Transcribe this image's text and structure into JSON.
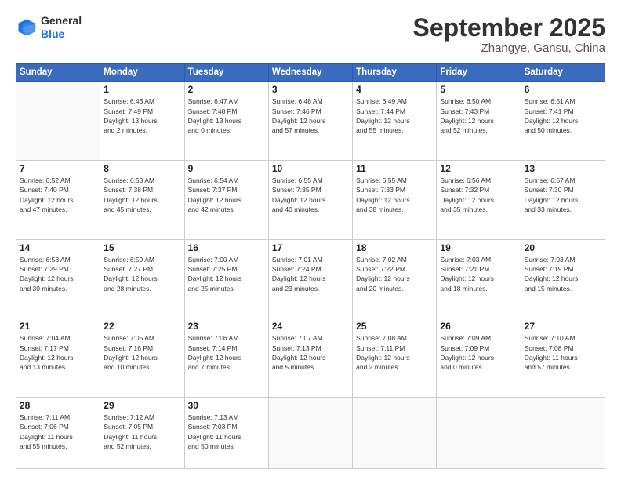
{
  "logo": {
    "line1": "General",
    "line2": "Blue"
  },
  "header": {
    "title": "September 2025",
    "subtitle": "Zhangye, Gansu, China"
  },
  "weekdays": [
    "Sunday",
    "Monday",
    "Tuesday",
    "Wednesday",
    "Thursday",
    "Friday",
    "Saturday"
  ],
  "weeks": [
    [
      {
        "day": "",
        "info": ""
      },
      {
        "day": "1",
        "info": "Sunrise: 6:46 AM\nSunset: 7:49 PM\nDaylight: 13 hours\nand 2 minutes."
      },
      {
        "day": "2",
        "info": "Sunrise: 6:47 AM\nSunset: 7:48 PM\nDaylight: 13 hours\nand 0 minutes."
      },
      {
        "day": "3",
        "info": "Sunrise: 6:48 AM\nSunset: 7:46 PM\nDaylight: 12 hours\nand 57 minutes."
      },
      {
        "day": "4",
        "info": "Sunrise: 6:49 AM\nSunset: 7:44 PM\nDaylight: 12 hours\nand 55 minutes."
      },
      {
        "day": "5",
        "info": "Sunrise: 6:50 AM\nSunset: 7:43 PM\nDaylight: 12 hours\nand 52 minutes."
      },
      {
        "day": "6",
        "info": "Sunrise: 6:51 AM\nSunset: 7:41 PM\nDaylight: 12 hours\nand 50 minutes."
      }
    ],
    [
      {
        "day": "7",
        "info": "Sunrise: 6:52 AM\nSunset: 7:40 PM\nDaylight: 12 hours\nand 47 minutes."
      },
      {
        "day": "8",
        "info": "Sunrise: 6:53 AM\nSunset: 7:38 PM\nDaylight: 12 hours\nand 45 minutes."
      },
      {
        "day": "9",
        "info": "Sunrise: 6:54 AM\nSunset: 7:37 PM\nDaylight: 12 hours\nand 42 minutes."
      },
      {
        "day": "10",
        "info": "Sunrise: 6:55 AM\nSunset: 7:35 PM\nDaylight: 12 hours\nand 40 minutes."
      },
      {
        "day": "11",
        "info": "Sunrise: 6:55 AM\nSunset: 7:33 PM\nDaylight: 12 hours\nand 38 minutes."
      },
      {
        "day": "12",
        "info": "Sunrise: 6:56 AM\nSunset: 7:32 PM\nDaylight: 12 hours\nand 35 minutes."
      },
      {
        "day": "13",
        "info": "Sunrise: 6:57 AM\nSunset: 7:30 PM\nDaylight: 12 hours\nand 33 minutes."
      }
    ],
    [
      {
        "day": "14",
        "info": "Sunrise: 6:58 AM\nSunset: 7:29 PM\nDaylight: 12 hours\nand 30 minutes."
      },
      {
        "day": "15",
        "info": "Sunrise: 6:59 AM\nSunset: 7:27 PM\nDaylight: 12 hours\nand 28 minutes."
      },
      {
        "day": "16",
        "info": "Sunrise: 7:00 AM\nSunset: 7:25 PM\nDaylight: 12 hours\nand 25 minutes."
      },
      {
        "day": "17",
        "info": "Sunrise: 7:01 AM\nSunset: 7:24 PM\nDaylight: 12 hours\nand 23 minutes."
      },
      {
        "day": "18",
        "info": "Sunrise: 7:02 AM\nSunset: 7:22 PM\nDaylight: 12 hours\nand 20 minutes."
      },
      {
        "day": "19",
        "info": "Sunrise: 7:03 AM\nSunset: 7:21 PM\nDaylight: 12 hours\nand 18 minutes."
      },
      {
        "day": "20",
        "info": "Sunrise: 7:03 AM\nSunset: 7:19 PM\nDaylight: 12 hours\nand 15 minutes."
      }
    ],
    [
      {
        "day": "21",
        "info": "Sunrise: 7:04 AM\nSunset: 7:17 PM\nDaylight: 12 hours\nand 13 minutes."
      },
      {
        "day": "22",
        "info": "Sunrise: 7:05 AM\nSunset: 7:16 PM\nDaylight: 12 hours\nand 10 minutes."
      },
      {
        "day": "23",
        "info": "Sunrise: 7:06 AM\nSunset: 7:14 PM\nDaylight: 12 hours\nand 7 minutes."
      },
      {
        "day": "24",
        "info": "Sunrise: 7:07 AM\nSunset: 7:13 PM\nDaylight: 12 hours\nand 5 minutes."
      },
      {
        "day": "25",
        "info": "Sunrise: 7:08 AM\nSunset: 7:11 PM\nDaylight: 12 hours\nand 2 minutes."
      },
      {
        "day": "26",
        "info": "Sunrise: 7:09 AM\nSunset: 7:09 PM\nDaylight: 12 hours\nand 0 minutes."
      },
      {
        "day": "27",
        "info": "Sunrise: 7:10 AM\nSunset: 7:08 PM\nDaylight: 11 hours\nand 57 minutes."
      }
    ],
    [
      {
        "day": "28",
        "info": "Sunrise: 7:11 AM\nSunset: 7:06 PM\nDaylight: 11 hours\nand 55 minutes."
      },
      {
        "day": "29",
        "info": "Sunrise: 7:12 AM\nSunset: 7:05 PM\nDaylight: 11 hours\nand 52 minutes."
      },
      {
        "day": "30",
        "info": "Sunrise: 7:13 AM\nSunset: 7:03 PM\nDaylight: 11 hours\nand 50 minutes."
      },
      {
        "day": "",
        "info": ""
      },
      {
        "day": "",
        "info": ""
      },
      {
        "day": "",
        "info": ""
      },
      {
        "day": "",
        "info": ""
      }
    ]
  ]
}
